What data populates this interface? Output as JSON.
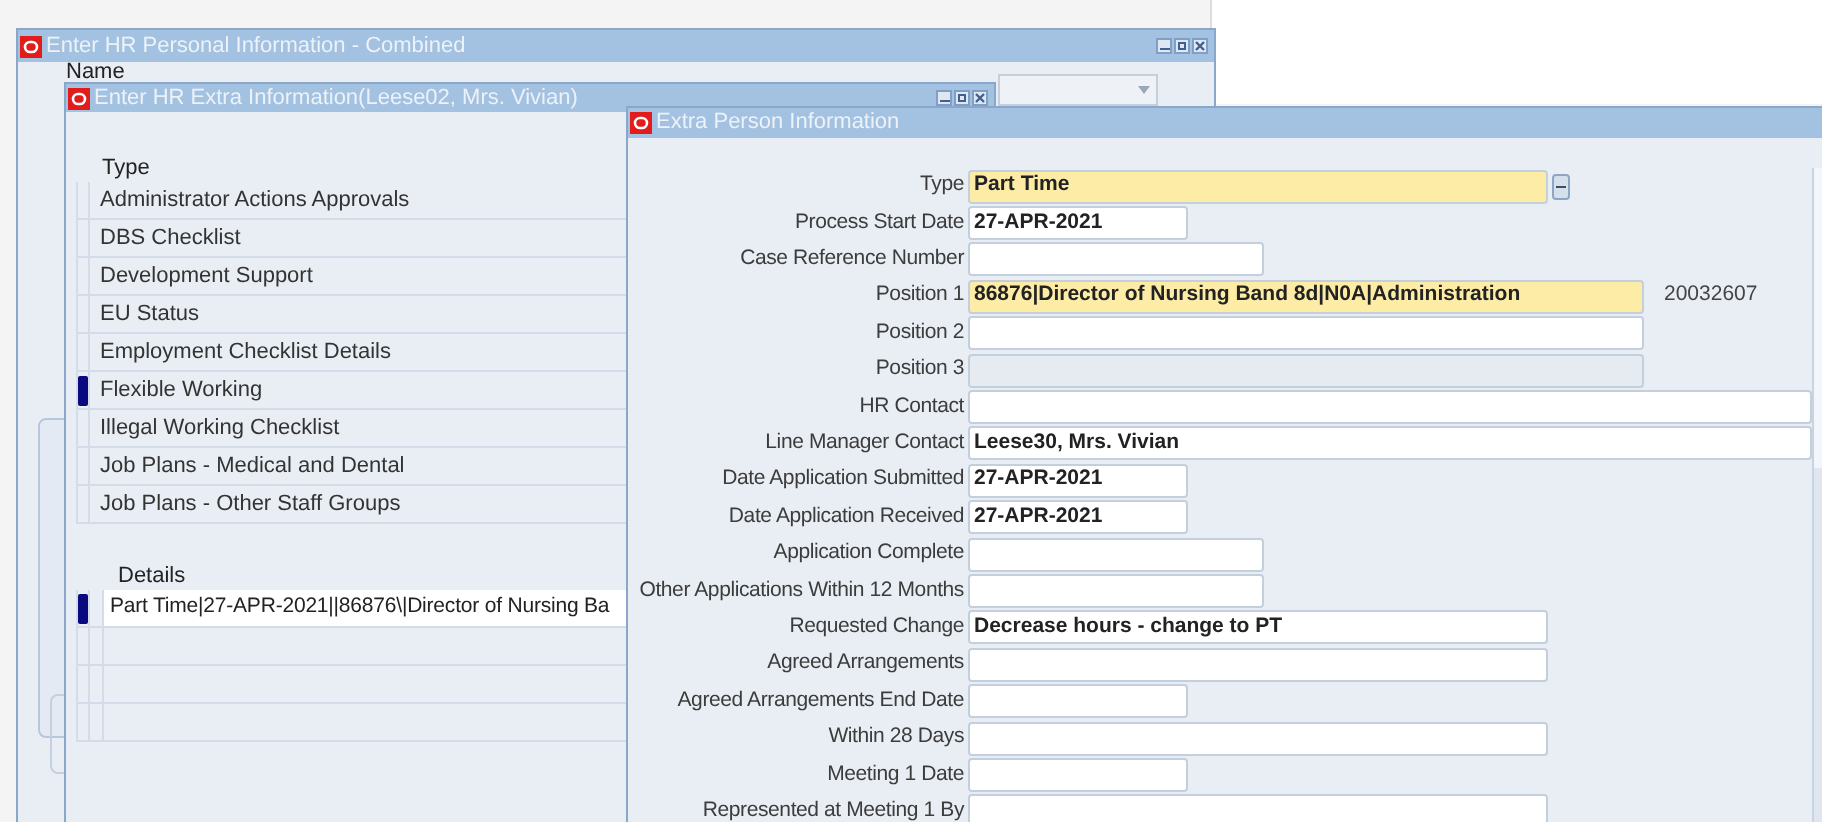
{
  "windows": [
    {
      "title": "Enter HR Personal Information - Combined",
      "name_label": "Name"
    },
    {
      "title": "Enter HR Extra Information(Leese02, Mrs. Vivian)",
      "type_heading": "Type",
      "types": [
        {
          "label": "Administrator Actions Approvals",
          "selected": false
        },
        {
          "label": "DBS Checklist",
          "selected": false
        },
        {
          "label": "Development Support",
          "selected": false
        },
        {
          "label": "EU Status",
          "selected": false
        },
        {
          "label": "Employment Checklist Details",
          "selected": false
        },
        {
          "label": "Flexible Working",
          "selected": true
        },
        {
          "label": "Illegal Working Checklist",
          "selected": false
        },
        {
          "label": "Job Plans - Medical and Dental",
          "selected": false
        },
        {
          "label": "Job Plans - Other Staff Groups",
          "selected": false
        }
      ],
      "details_heading": "Details",
      "details": [
        {
          "value": "Part Time|27-APR-2021||86876\\|Director of Nursing Ba",
          "selected": true
        },
        {
          "selected": false
        },
        {
          "selected": false
        },
        {
          "selected": false
        }
      ]
    },
    {
      "title": "Extra Person Information",
      "fields": [
        {
          "label": "Type",
          "value": "Part Time",
          "required": true,
          "disabled": false
        },
        {
          "label": "Process Start Date",
          "value": "27-APR-2021",
          "required": false,
          "disabled": false
        },
        {
          "label": "Case Reference Number",
          "required": false,
          "disabled": false
        },
        {
          "label": "Position 1",
          "value": "86876|Director of Nursing Band 8d|N0A|Administration",
          "required": true,
          "disabled": false,
          "note": "20032607"
        },
        {
          "label": "Position 2",
          "required": false,
          "disabled": false
        },
        {
          "label": "Position 3",
          "required": false,
          "disabled": true
        },
        {
          "label": "HR Contact",
          "required": false,
          "disabled": false
        },
        {
          "label": "Line Manager Contact",
          "value": "Leese30, Mrs. Vivian",
          "required": false,
          "disabled": false
        },
        {
          "label": "Date Application Submitted",
          "value": "27-APR-2021",
          "required": false,
          "disabled": false
        },
        {
          "label": "Date Application Received",
          "value": "27-APR-2021",
          "required": false,
          "disabled": false
        },
        {
          "label": "Application Complete",
          "required": false,
          "disabled": false
        },
        {
          "label": "Other Applications Within 12 Months",
          "required": false,
          "disabled": false
        },
        {
          "label": "Requested Change",
          "value": "Decrease hours - change to PT",
          "required": false,
          "disabled": false
        },
        {
          "label": "Agreed Arrangements",
          "required": false,
          "disabled": false
        },
        {
          "label": "Agreed Arrangements End Date",
          "required": false,
          "disabled": false
        },
        {
          "label": "Within 28 Days",
          "required": false,
          "disabled": false
        },
        {
          "label": "Meeting 1 Date",
          "required": false,
          "disabled": false
        },
        {
          "label": "Represented at Meeting 1 By",
          "required": false,
          "disabled": false
        }
      ]
    }
  ]
}
